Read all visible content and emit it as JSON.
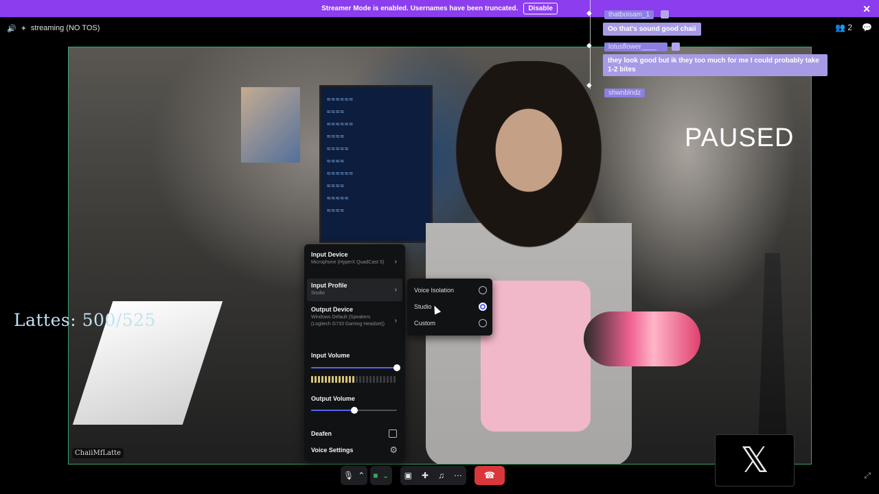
{
  "banner": {
    "text": "Streamer Mode is enabled. Usernames have been truncated.",
    "button": "Disable",
    "close": "✕"
  },
  "header": {
    "channel": "streaming (NO TOS)",
    "participants": "2"
  },
  "video": {
    "paused": "PAUSED",
    "counter": "Lattes: 500/525",
    "participant_name": "ChaiiMfLatte"
  },
  "chat": [
    {
      "user": "thatboisam_1",
      "message": "Oo that's sound good chaii"
    },
    {
      "user": "lotusflower____",
      "message": "they look good but ik they too much for me I could probably take 1-2 bites"
    },
    {
      "user": "shwnblndz",
      "message": ""
    }
  ],
  "voice_menu": {
    "input_device_label": "Input Device",
    "input_device_value": "Microphone (HyperX QuadCast S)",
    "input_profile_label": "Input Profile",
    "input_profile_value": "Studio",
    "output_device_label": "Output Device",
    "output_device_value": "Windows Default (Speakers (Logitech G733 Gaming Headset))",
    "input_volume_label": "Input Volume",
    "input_volume": 1.0,
    "output_volume_label": "Output Volume",
    "output_volume": 0.5,
    "deafen_label": "Deafen",
    "voice_settings_label": "Voice Settings"
  },
  "input_profiles": {
    "options": [
      "Voice Isolation",
      "Studio",
      "Custom"
    ],
    "selected": "Studio"
  },
  "colors": {
    "banner": "#8c3dee",
    "accent": "#5865f2",
    "hangup": "#da373c",
    "camera_on": "#3ba55d"
  }
}
